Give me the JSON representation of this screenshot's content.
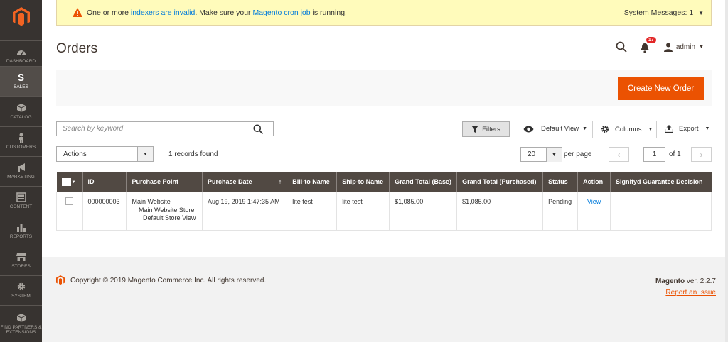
{
  "sidebar": {
    "items": [
      {
        "label": "Dashboard",
        "icon": "speedometer-icon"
      },
      {
        "label": "$",
        "label2": "Sales",
        "icon": "dollar-icon"
      },
      {
        "label": "Catalog",
        "icon": "cube-icon"
      },
      {
        "label": "Customers",
        "icon": "person-icon"
      },
      {
        "label": "Marketing",
        "icon": "megaphone-icon"
      },
      {
        "label": "Content",
        "icon": "layout-icon"
      },
      {
        "label": "Reports",
        "icon": "bar-chart-icon"
      },
      {
        "label": "Stores",
        "icon": "storefront-icon"
      },
      {
        "label": "System",
        "icon": "gear-icon"
      },
      {
        "label": "Find Partners & Extensions",
        "icon": "box-icon"
      }
    ]
  },
  "message": {
    "prefix": "One or more ",
    "link1": "indexers are invalid",
    "middle": ". Make sure your ",
    "link2": "Magento cron job",
    "suffix": " is running.",
    "system": "System Messages: 1"
  },
  "page": {
    "title": "Orders"
  },
  "header": {
    "notifications": "17",
    "user": "admin"
  },
  "actionbar": {
    "create": "Create New Order"
  },
  "toolbar": {
    "search_placeholder": "Search by keyword",
    "filters": "Filters",
    "view": "Default View",
    "columns": "Columns",
    "export": "Export",
    "actions": "Actions",
    "records": "1 records found",
    "per_page_value": "20",
    "per_page_label": "per page",
    "page": "1",
    "of": "of 1"
  },
  "grid": {
    "columns": [
      "ID",
      "Purchase Point",
      "Purchase Date",
      "Bill-to Name",
      "Ship-to Name",
      "Grand Total (Base)",
      "Grand Total (Purchased)",
      "Status",
      "Action",
      "Signifyd Guarantee Decision"
    ],
    "sort_indicator": "↑",
    "rows": [
      {
        "id": "000000003",
        "point1": "Main Website",
        "point2": "Main Website Store",
        "point3": "Default Store View",
        "date": "Aug 19, 2019 1:47:35 AM",
        "bill": "lite test",
        "ship": "lite test",
        "total_base": "$1,085.00",
        "total_purchased": "$1,085.00",
        "status": "Pending",
        "action": "View",
        "signifyd": ""
      }
    ]
  },
  "footer": {
    "copyright": "Copyright © 2019 Magento Commerce Inc. All rights reserved.",
    "brand": "Magento",
    "version": " ver. 2.2.7",
    "report": "Report an Issue"
  },
  "colors": {
    "accent": "#eb5202",
    "sidebar": "#373330",
    "header": "#514943",
    "link": "#007bdb"
  }
}
